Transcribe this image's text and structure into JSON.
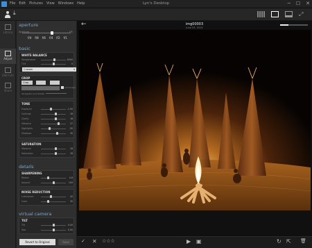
{
  "window": {
    "title": "Lyn's Desktop",
    "menu": [
      "File",
      "Edit",
      "Pictures",
      "View",
      "Windows",
      "Help"
    ],
    "controls": [
      "─",
      "☐",
      "✕"
    ]
  },
  "nav": [
    {
      "label": "Library",
      "active": false
    },
    {
      "label": "Adjust",
      "active": true
    },
    {
      "label": "Edit Info",
      "active": false
    },
    {
      "label": "Share",
      "active": false
    }
  ],
  "panel": {
    "aperture": {
      "section": "aperture",
      "label": "Aperture",
      "value": "f/8",
      "level": 0.62,
      "stops": [
        "f/4",
        "f/8",
        "f/6",
        "f/4",
        "f/2",
        "f/1"
      ]
    },
    "basic": {
      "section": "basic",
      "white_balance": {
        "title": "WHITE BALANCE",
        "rows": [
          {
            "label": "Temperature",
            "value": "6500",
            "level": 0.55
          },
          {
            "label": "Tint",
            "value": "0",
            "level": 0.5
          }
        ],
        "preset": "Custom"
      },
      "crop": {
        "title": "CROP",
        "mode": "Crop",
        "width": "",
        "height": "",
        "ratio": "",
        "checkbox_label": "Landscape",
        "rotation_label": "Straighten and Rotate"
      },
      "tone": {
        "title": "TONE",
        "rows": [
          {
            "label": "Exposure",
            "value": "-1.00",
            "level": 0.4
          },
          {
            "label": "Contrast",
            "value": "18",
            "level": 0.6
          },
          {
            "label": "Clarity",
            "value": "18",
            "level": 0.6
          },
          {
            "label": "Vibrance",
            "value": "37",
            "level": 0.7
          },
          {
            "label": "Highlights",
            "value": "-30",
            "level": 0.35
          },
          {
            "label": "Shadows",
            "value": "30",
            "level": 0.65
          }
        ]
      },
      "saturation": {
        "title": "SATURATION",
        "rows": [
          {
            "label": "Vibrance",
            "value": "18",
            "level": 0.6
          },
          {
            "label": "Saturation",
            "value": "18",
            "level": 0.6
          }
        ]
      }
    },
    "details": {
      "section": "details",
      "sharpening": {
        "title": "SHARPENING",
        "rows": [
          {
            "label": "Radius",
            "value": "0.6",
            "level": 0.3
          },
          {
            "label": "Amount",
            "value": "100",
            "level": 0.5
          }
        ]
      },
      "noise_reduction": {
        "title": "NOISE REDUCTION",
        "rows": [
          {
            "label": "Luminance",
            "value": "40",
            "level": 0.4
          },
          {
            "label": "Color",
            "value": "30",
            "level": 0.3
          }
        ]
      }
    },
    "virtual_camera": {
      "section": "virtual camera",
      "tilt": {
        "title": "TILT",
        "rows": [
          {
            "label": "Tilt",
            "value": "0.00",
            "level": 0.5
          },
          {
            "label": "Yaw",
            "value": "0.00",
            "level": 0.5
          }
        ]
      }
    },
    "revert_label": "Revert to Original",
    "save_label": "Save"
  },
  "viewer": {
    "image_name": "img00003",
    "image_date": "June 03, 2014",
    "zoom_level": 0.3
  },
  "bottom": {
    "rating": "☆☆☆",
    "check": "✓",
    "reject": "✕",
    "play": "▶",
    "slideshow": "▣",
    "rotate": "↻",
    "export": "⇱",
    "trash": "🗑"
  }
}
